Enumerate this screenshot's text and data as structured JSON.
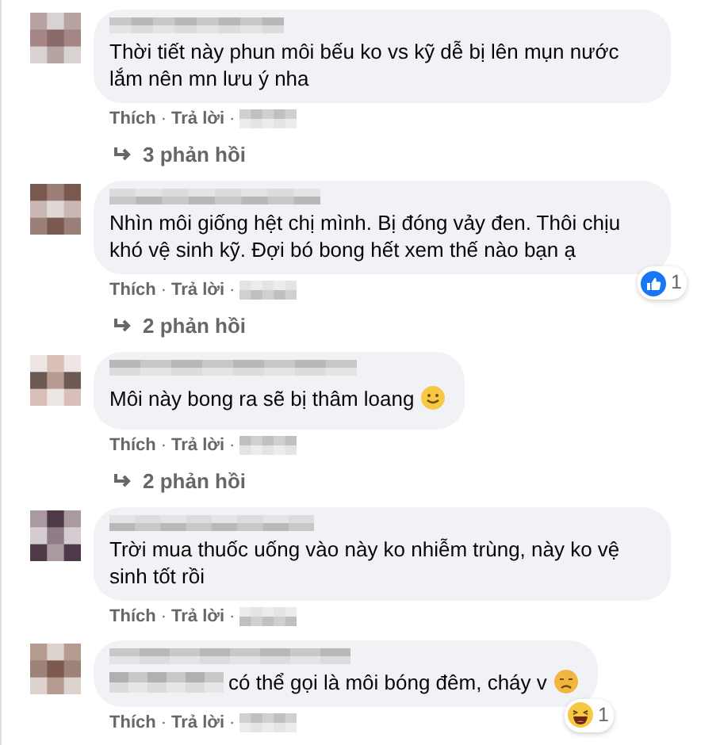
{
  "comments": [
    {
      "text": "Thời tiết này phun môi bếu ko vs kỹ dễ bị lên mụn nước lắm nên mn lưu ý nha",
      "like_label": "Thích",
      "reply_label": "Trả lời",
      "separator": "·",
      "replies": "3 phản hồi"
    },
    {
      "text": "Nhìn môi giống hệt chị mình. Bị đóng vảy đen. Thôi chịu khó vệ sinh kỹ. Đợi bó bong hết xem thế nào bạn ạ",
      "like_label": "Thích",
      "reply_label": "Trả lời",
      "separator": "·",
      "reaction": {
        "kind": "like",
        "count": "1"
      },
      "replies": "2 phản hồi"
    },
    {
      "text": "Môi này bong ra sẽ bị thâm loang",
      "emoji": {
        "kind": "smile"
      },
      "like_label": "Thích",
      "reply_label": "Trả lời",
      "separator": "·",
      "replies": "2 phản hồi"
    },
    {
      "text": "Trời mua thuốc uống vào này ko nhiễm trùng, này ko vệ sinh tốt rồi",
      "like_label": "Thích",
      "reply_label": "Trả lời",
      "separator": "·"
    },
    {
      "text": "có thể gọi là môi bóng đêm, cháy v",
      "text_blurred_start": true,
      "emoji": {
        "kind": "sad"
      },
      "like_label": "Thích",
      "reply_label": "Trả lời",
      "separator": "·",
      "reaction": {
        "kind": "haha",
        "count": "1"
      }
    }
  ]
}
